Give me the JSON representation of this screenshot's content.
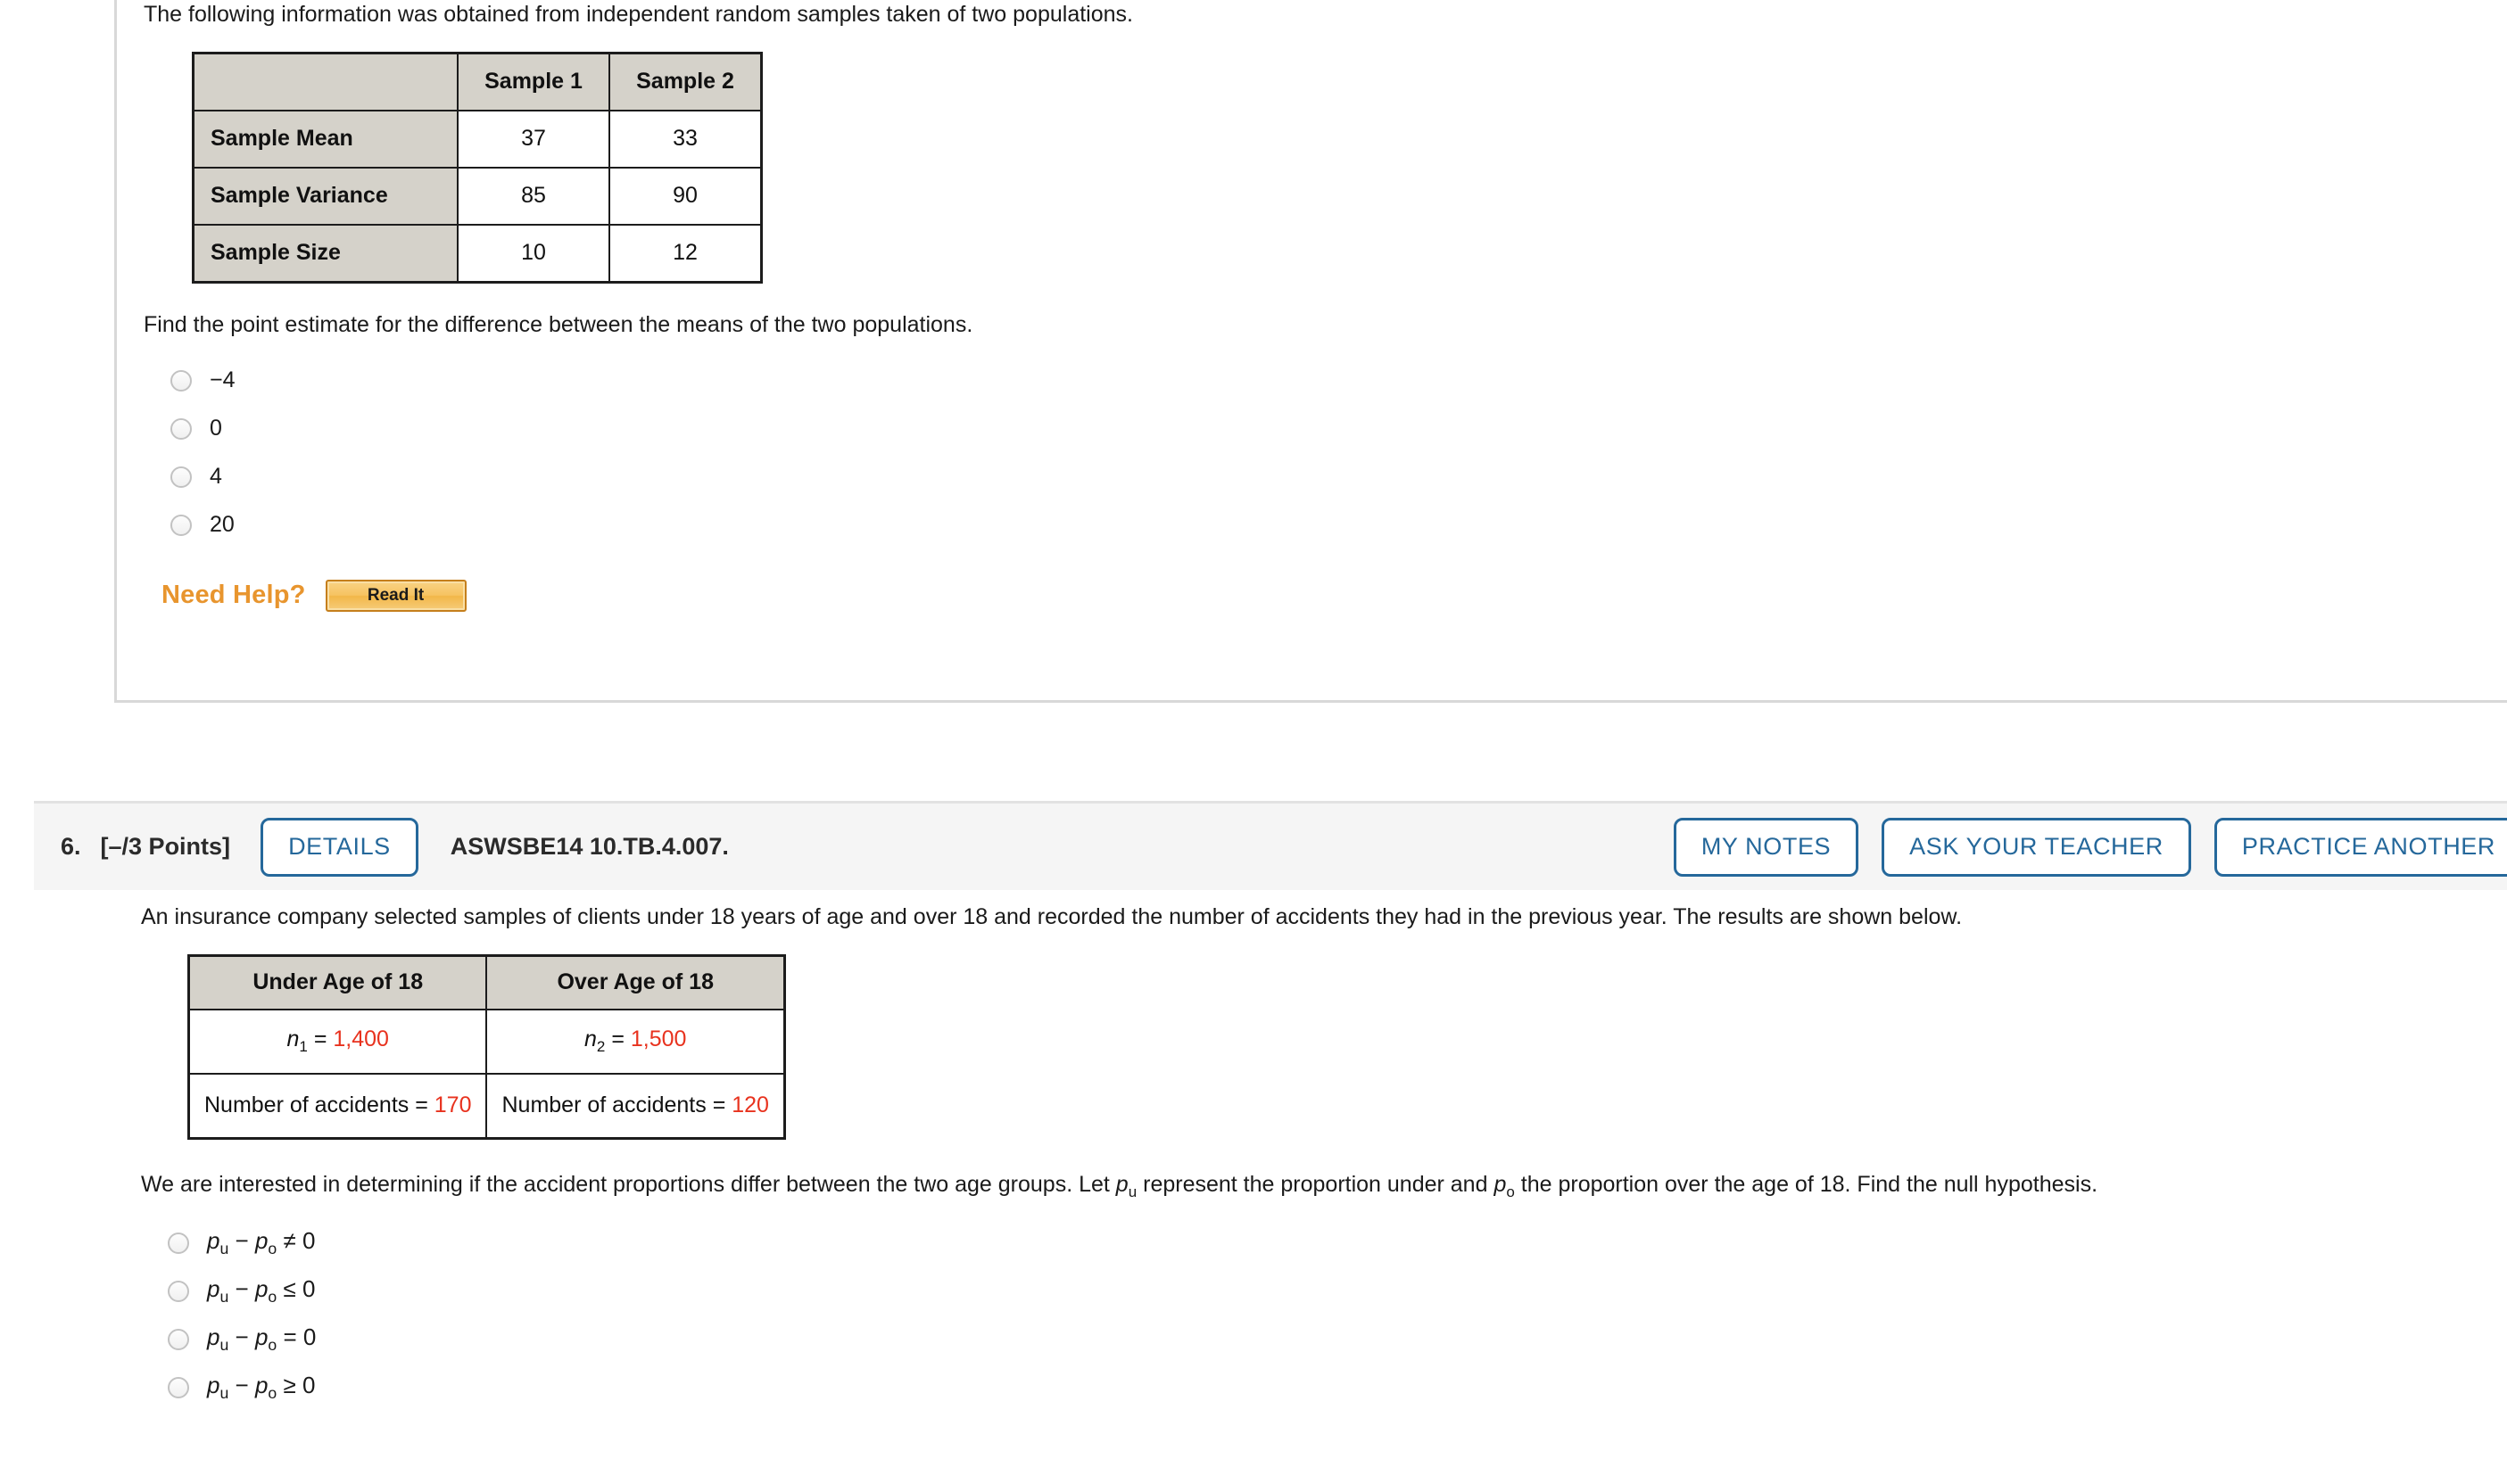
{
  "question5": {
    "prompt": "The following information was obtained from independent random samples taken of two populations.",
    "table": {
      "corner": "",
      "headers": [
        "Sample 1",
        "Sample 2"
      ],
      "rows": [
        {
          "label": "Sample Mean",
          "values": [
            "37",
            "33"
          ],
          "highlight": true
        },
        {
          "label": "Sample Variance",
          "values": [
            "85",
            "90"
          ],
          "highlight": false
        },
        {
          "label": "Sample Size",
          "values": [
            "10",
            "12"
          ],
          "highlight": false
        }
      ]
    },
    "sub_prompt": "Find the point estimate for the difference between the means of the two populations.",
    "options": [
      "−4",
      "0",
      "4",
      "20"
    ],
    "need_help": {
      "label": "Need Help?",
      "read_it_label": "Read It"
    }
  },
  "question6": {
    "number": "6.",
    "points": "[–/3 Points]",
    "details_label": "DETAILS",
    "code": "ASWSBE14 10.TB.4.007.",
    "actions": [
      "MY NOTES",
      "ASK YOUR TEACHER",
      "PRACTICE ANOTHER"
    ],
    "prompt": "An insurance company selected samples of clients under 18 years of age and over 18 and recorded the number of accidents they had in the previous year. The results are shown below.",
    "table": {
      "headers": [
        "Under Age of 18",
        "Over Age of 18"
      ],
      "row_n": {
        "left_symbol": "n",
        "left_sub": "1",
        "left_eq": " = ",
        "left_value": "1,400",
        "right_symbol": "n",
        "right_sub": "2",
        "right_eq": " = ",
        "right_value": "1,500"
      },
      "row_accidents": {
        "left_text": "Number of accidents = ",
        "left_value": "170",
        "right_text": "Number of accidents = ",
        "right_value": "120"
      }
    },
    "paragraph_part1": "We are interested in determining if the accident proportions differ between the two age groups. Let ",
    "paragraph_p_u": "p",
    "paragraph_p_u_sub": "u",
    "paragraph_part2": " represent the proportion under and ",
    "paragraph_p_o": "p",
    "paragraph_p_o_sub": "o",
    "paragraph_part3": " the proportion over the age of 18. Find the null hypothesis.",
    "options": [
      {
        "p1": "p",
        "s1": "u",
        "op1": " − ",
        "p2": "p",
        "s2": "o",
        "rel": " ≠ 0"
      },
      {
        "p1": "p",
        "s1": "u",
        "op1": " − ",
        "p2": "p",
        "s2": "o",
        "rel": " ≤ 0"
      },
      {
        "p1": "p",
        "s1": "u",
        "op1": " − ",
        "p2": "p",
        "s2": "o",
        "rel": " = 0"
      },
      {
        "p1": "p",
        "s1": "u",
        "op1": " − ",
        "p2": "p",
        "s2": "o",
        "rel": " ≥ 0"
      }
    ]
  },
  "colors": {
    "accent_blue": "#25689b",
    "highlight_red": "#e8321e",
    "need_help_orange": "#e8952e",
    "table_header_gray": "#d5d2ca"
  }
}
